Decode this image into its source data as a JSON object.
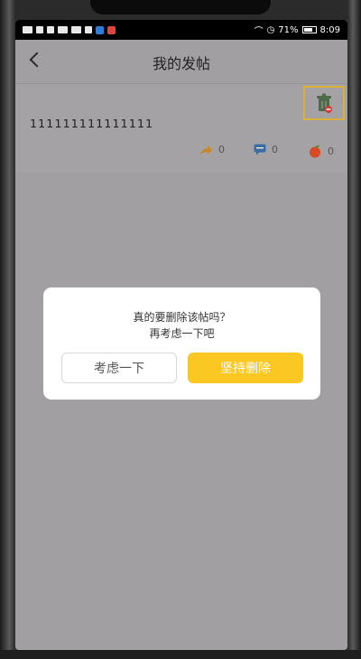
{
  "status": {
    "time": "8:09",
    "battery": "71%"
  },
  "header": {
    "title": "我的发帖"
  },
  "post": {
    "text": "111111111111111",
    "shares": "0",
    "comments": "0",
    "likes": "0"
  },
  "dialog": {
    "message_line1": "真的要删除该帖吗？",
    "message_line2": "再考虑一下吧",
    "cancel_label": "考虑一下",
    "confirm_label": "坚持删除"
  },
  "icons": {
    "back": "chevron-left",
    "delete": "trash-can",
    "share": "share-arrow",
    "comment": "speech-bubble",
    "like": "apple"
  },
  "colors": {
    "accent": "#fbc722",
    "overlay": "#a29fa2",
    "highlight": "#d9b03a"
  }
}
